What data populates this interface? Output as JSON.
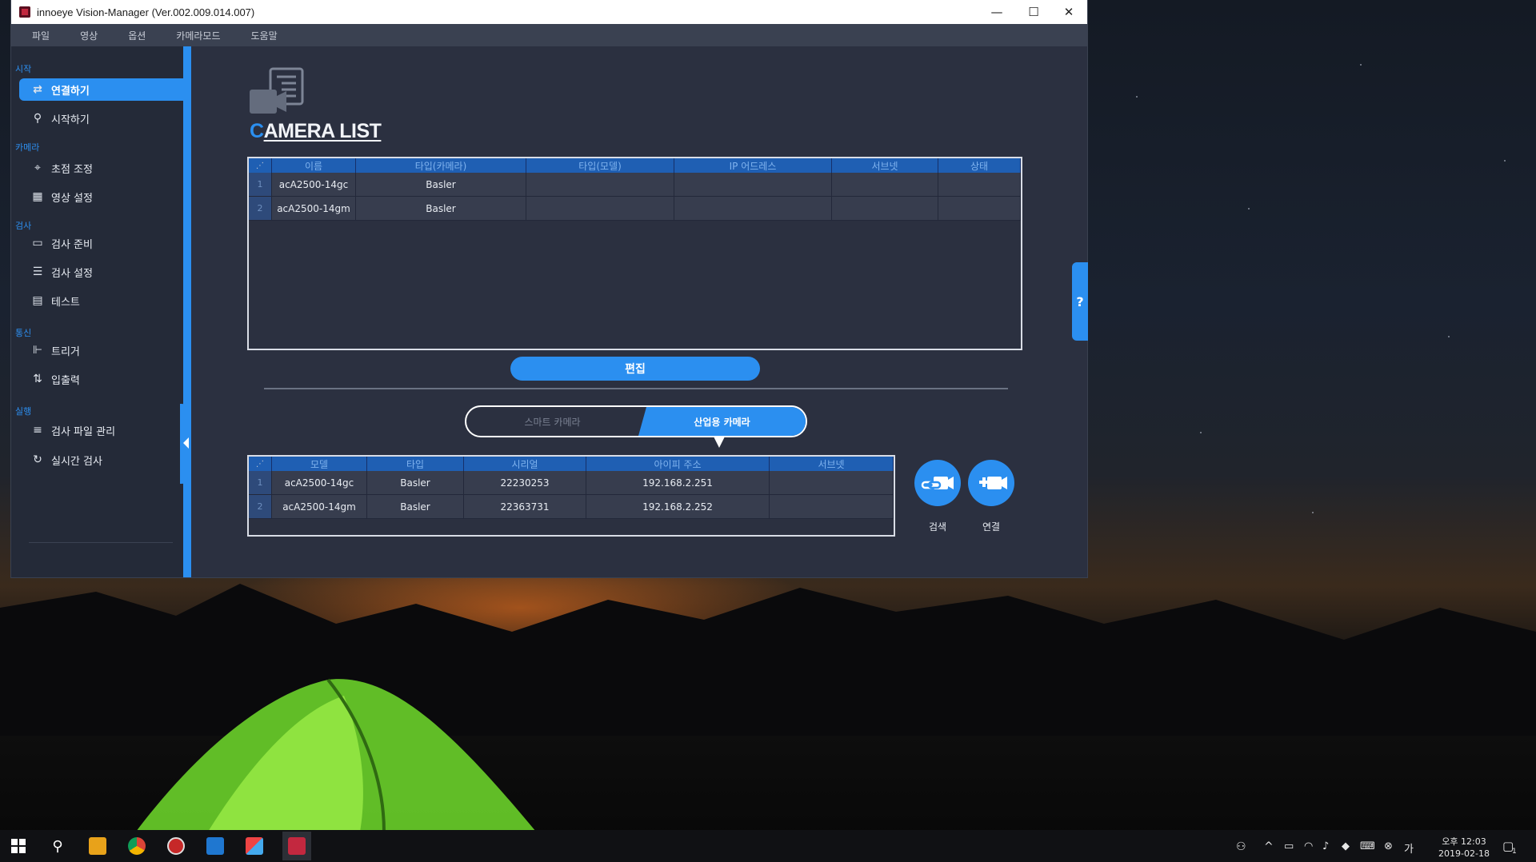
{
  "window": {
    "title": "innoeye Vision-Manager (Ver.002.009.014.007)",
    "minimize": "—",
    "maximize": "☐",
    "close": "✕"
  },
  "menu": [
    "파일",
    "영상",
    "옵션",
    "카메라모드",
    "도움말"
  ],
  "sidebar": {
    "sections": [
      {
        "label": "시작",
        "items": [
          {
            "label": "연결하기",
            "icon": "connect-icon",
            "active": true
          },
          {
            "label": "시작하기",
            "icon": "search-icon"
          }
        ]
      },
      {
        "label": "카메라",
        "items": [
          {
            "label": "초점 조정",
            "icon": "focus-icon"
          },
          {
            "label": "영상 설정",
            "icon": "image-settings-icon"
          }
        ]
      },
      {
        "label": "검사",
        "items": [
          {
            "label": "검사 준비",
            "icon": "folder-icon"
          },
          {
            "label": "검사 설정",
            "icon": "checklist-icon"
          },
          {
            "label": "테스트",
            "icon": "clipboard-icon"
          }
        ]
      },
      {
        "label": "통신",
        "items": [
          {
            "label": "트리거",
            "icon": "trigger-icon"
          },
          {
            "label": "입출력",
            "icon": "io-icon"
          }
        ]
      },
      {
        "label": "실행",
        "items": [
          {
            "label": "검사 파일 관리",
            "icon": "list-icon"
          },
          {
            "label": "실시간 검사",
            "icon": "realtime-icon"
          }
        ]
      }
    ]
  },
  "page": {
    "title_first": "C",
    "title_rest": "AMERA LIST"
  },
  "camera_list": {
    "columns": [
      "이름",
      "타입(카메라)",
      "타입(모델)",
      "IP 어드레스",
      "서브넷",
      "상태"
    ],
    "rows": [
      {
        "idx": "1",
        "cells": [
          "acA2500-14gc",
          "Basler",
          "",
          "",
          "",
          ""
        ]
      },
      {
        "idx": "2",
        "cells": [
          "acA2500-14gm",
          "Basler",
          "",
          "",
          "",
          ""
        ]
      }
    ]
  },
  "edit_button": "편집",
  "segment": {
    "left": "스마트 카메라",
    "right": "산업용 카메라",
    "selected": "right"
  },
  "found_list": {
    "columns": [
      "모델",
      "타입",
      "시리얼",
      "아이피 주소",
      "서브넷"
    ],
    "rows": [
      {
        "idx": "1",
        "cells": [
          "acA2500-14gc",
          "Basler",
          "22230253",
          "192.168.2.251",
          ""
        ]
      },
      {
        "idx": "2",
        "cells": [
          "acA2500-14gm",
          "Basler",
          "22363731",
          "192.168.2.252",
          ""
        ]
      }
    ]
  },
  "actions": {
    "search_label": "검색",
    "connect_label": "연결"
  },
  "help_label": "?",
  "taskbar": {
    "time": "오후 12:03",
    "date": "2019-02-18",
    "notification_count": "1"
  },
  "colors": {
    "accent": "#2b8ff0",
    "panel": "#2b3040",
    "sidebar": "#242a38",
    "header_cell": "#1f5fb3"
  }
}
